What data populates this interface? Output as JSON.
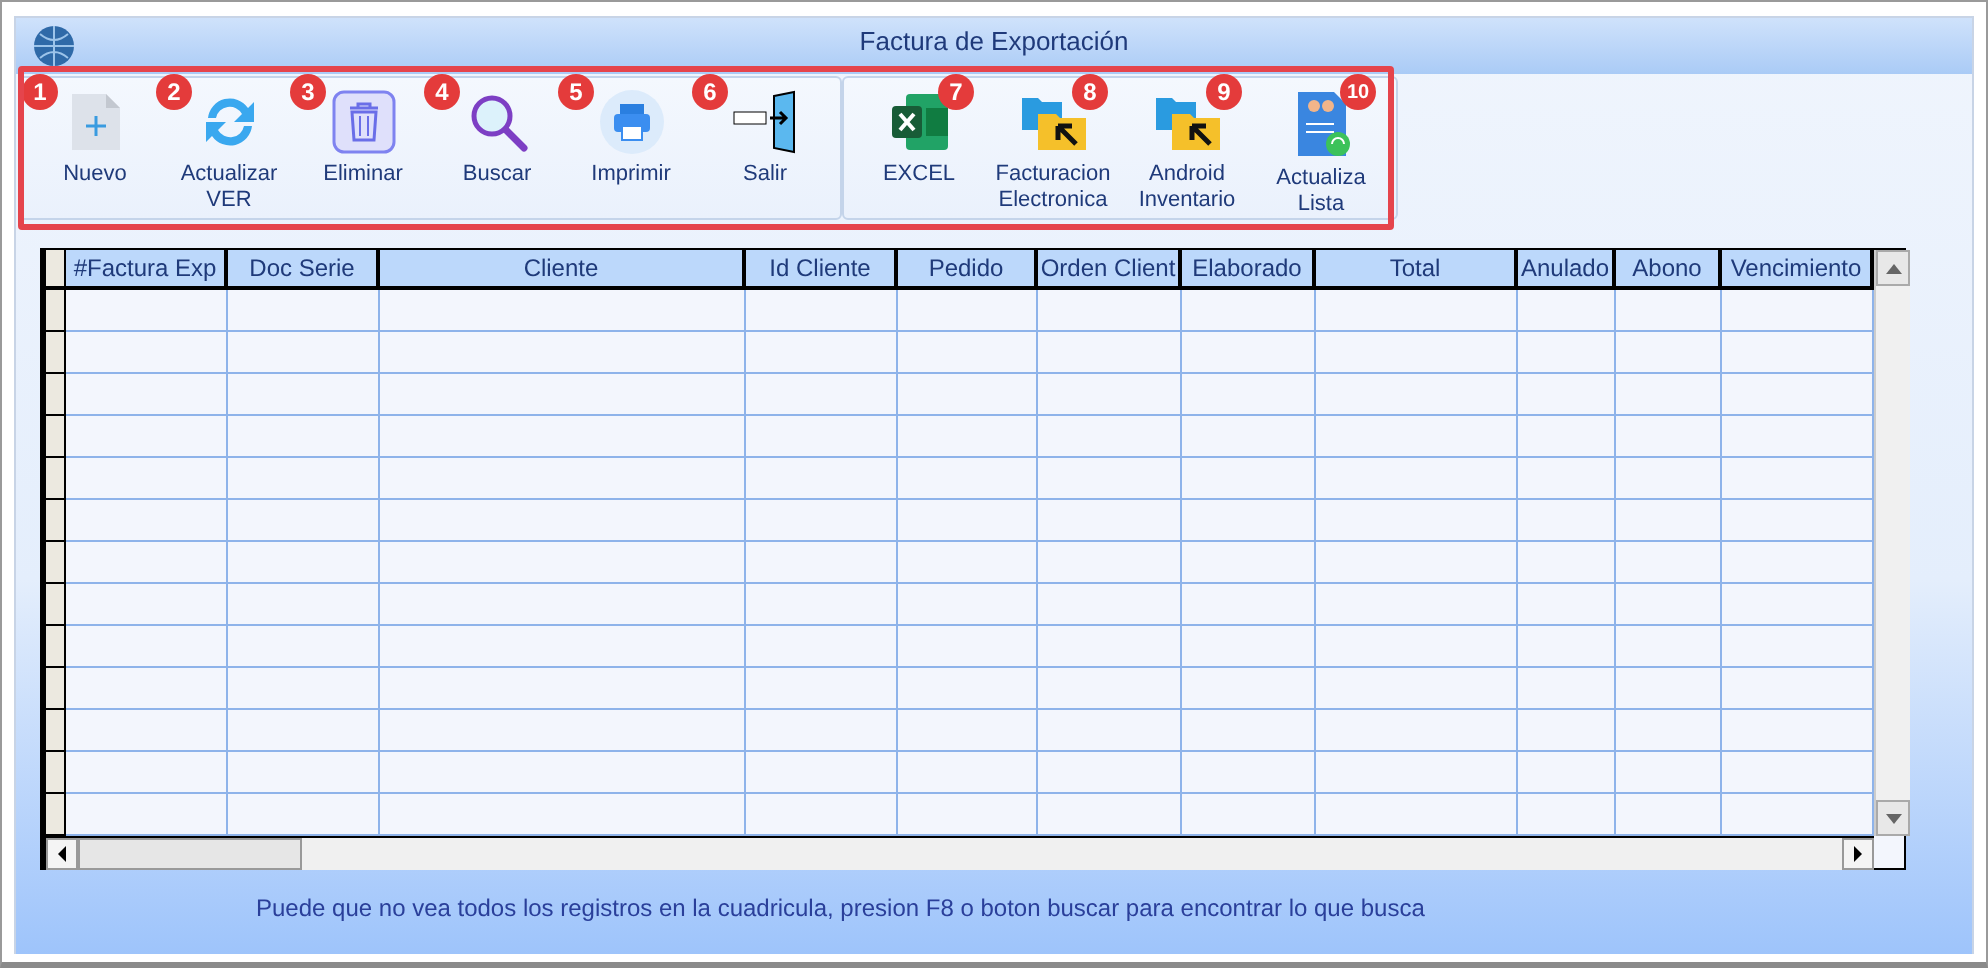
{
  "window": {
    "title": "Factura de Exportación"
  },
  "toolbar": {
    "groups": [
      [
        {
          "kind": "new",
          "label": "Nuevo",
          "badge": "1"
        },
        {
          "kind": "refresh",
          "label": "Actualizar\nVER",
          "badge": "2"
        },
        {
          "kind": "delete",
          "label": "Eliminar",
          "badge": "3"
        },
        {
          "kind": "search",
          "label": "Buscar",
          "badge": "4"
        },
        {
          "kind": "print",
          "label": "Imprimir",
          "badge": "5"
        },
        {
          "kind": "exit",
          "label": "Salir",
          "badge": "6"
        }
      ],
      [
        {
          "kind": "excel",
          "label": "EXCEL",
          "badge": "7"
        },
        {
          "kind": "folder",
          "label": "Facturacion\nElectronica",
          "badge": "8"
        },
        {
          "kind": "folder",
          "label": "Android\nInventario",
          "badge": "9"
        },
        {
          "kind": "list",
          "label": "Actualiza\nLista",
          "badge": "10"
        }
      ]
    ]
  },
  "table": {
    "columns": [
      "#Factura Exp",
      "Doc Serie",
      "Cliente",
      "Id Cliente",
      "Pedido",
      "Orden Client",
      "Elaborado",
      "Total",
      "Anulado",
      "Abono",
      "Vencimiento"
    ]
  },
  "hint": "Puede que no vea todos los registros en la cuadricula, presion F8 o boton buscar para encontrar lo que busca"
}
